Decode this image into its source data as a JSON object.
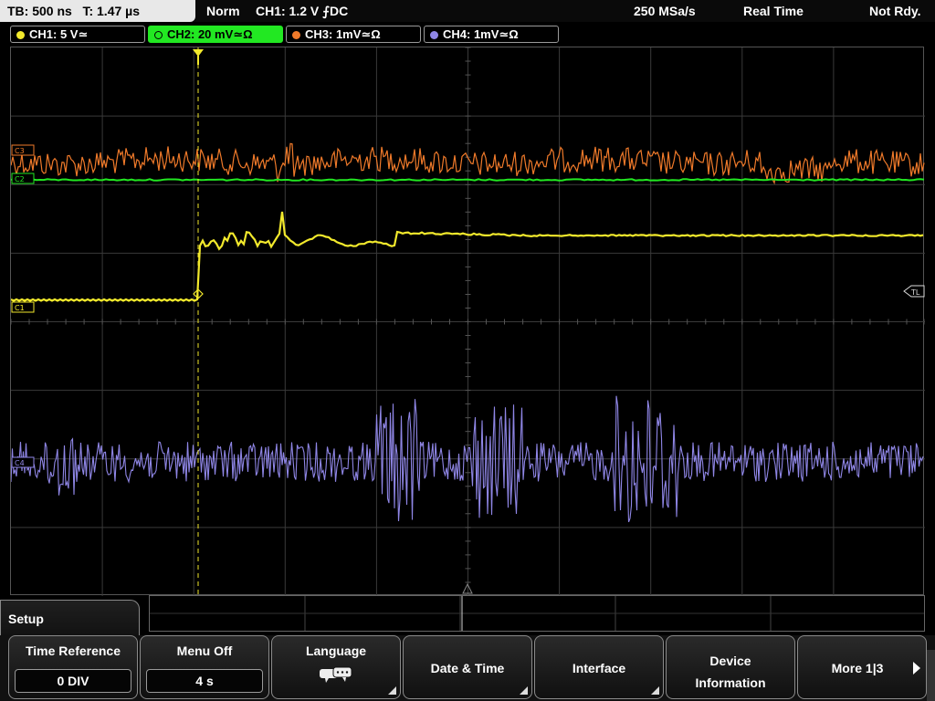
{
  "status_bar": {
    "timebase": "TB: 500 ns   T: 1.47 µs",
    "trigger_mode": "Norm",
    "trigger_setting": "CH1: 1.2 V ⨍DC",
    "sample_rate": "250 MSa/s",
    "acquisition_mode": "Real Time",
    "state": "Not Rdy."
  },
  "channels": [
    {
      "label": "CH1: 5 V≃",
      "color": "#f2e92c",
      "active": false
    },
    {
      "label": "CH2: 20 mV≃Ω",
      "color": "#22e822",
      "active": true
    },
    {
      "label": "CH3: 1mV≃Ω",
      "color": "#f07a2a",
      "active": false
    },
    {
      "label": "CH4: 1mV≃Ω",
      "color": "#8f86e6",
      "active": false
    }
  ],
  "display": {
    "channel_markers": [
      "C3",
      "C2",
      "C1",
      "C4"
    ],
    "trigger_level_marker": "TL"
  },
  "menu": {
    "title": "Setup",
    "softkeys": [
      {
        "label": "Time Reference",
        "value": "0 DIV"
      },
      {
        "label": "Menu Off",
        "value": "4 s"
      },
      {
        "label": "Language",
        "icon": "speech-bubbles-icon"
      },
      {
        "label": "Date & Time"
      },
      {
        "label": "Interface"
      },
      {
        "label": "Device Information"
      },
      {
        "label": "More 1|3"
      }
    ]
  }
}
